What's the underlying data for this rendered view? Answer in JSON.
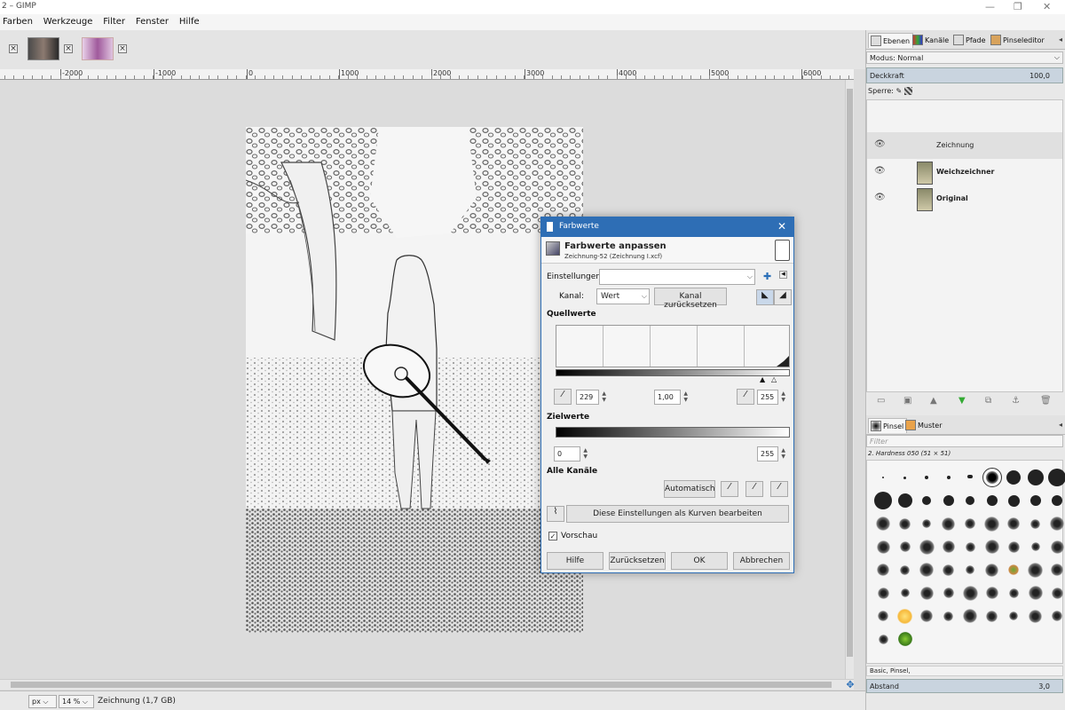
{
  "window": {
    "title": "2 – GIMP",
    "controls": [
      "—",
      "❐",
      "✕"
    ]
  },
  "menu": [
    "Farben",
    "Werkzeuge",
    "Filter",
    "Fenster",
    "Hilfe"
  ],
  "ruler": {
    "labels": [
      "-2000",
      "-1000",
      "0",
      "1000",
      "2000",
      "3000",
      "4000",
      "5000",
      "6000"
    ]
  },
  "status": {
    "unit": "px",
    "zoom": "14 %",
    "layer_info": "Zeichnung (1,7 GB)"
  },
  "dock": {
    "tabs": [
      "Ebenen",
      "Kanäle",
      "Pfade",
      "Pinseleditor"
    ],
    "mode_label": "Modus: Normal",
    "opacity_label": "Deckkraft",
    "opacity_value": "100,0",
    "lock_label": "Sperre:",
    "layers": [
      {
        "name": "Zeichnung",
        "selected": true
      },
      {
        "name": "Weichzeichner",
        "selected": false
      },
      {
        "name": "Original",
        "selected": false
      }
    ],
    "brush_tabs": [
      "Pinsel",
      "Muster"
    ],
    "filter_placeholder": "Filter",
    "brush_name": "2. Hardness 050 (51 × 51)",
    "brush_set": "Basic, Pinsel,",
    "spacing_label": "Abstand",
    "spacing_value": "3,0"
  },
  "dialog": {
    "title": "Farbwerte",
    "heading": "Farbwerte anpassen",
    "subheading": "Zeichnung-52 (Zeichnung I.xcf)",
    "settings_label": "Einstellungen:",
    "settings_value": "",
    "channel_label": "Kanal:",
    "channel_value": "Wert",
    "reset_channel": "Kanal zurücksetzen",
    "source_label": "Quellwerte",
    "input_low": "229",
    "input_gamma": "1,00",
    "input_high": "255",
    "target_label": "Zielwerte",
    "output_low": "0",
    "output_high": "255",
    "all_channels_label": "Alle Kanäle",
    "auto_button": "Automatisch",
    "curves_button": "Diese Einstellungen als Kurven bearbeiten",
    "preview_label": "Vorschau",
    "help_button": "Hilfe",
    "reset_button": "Zurücksetzen",
    "ok_button": "OK",
    "cancel_button": "Abbrechen"
  }
}
